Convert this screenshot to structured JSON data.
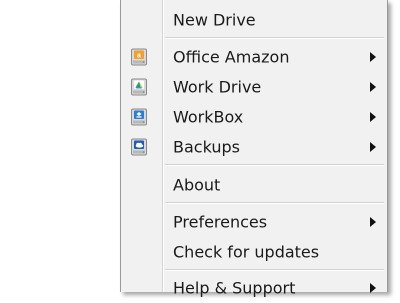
{
  "menu": {
    "new_drive": "New Drive",
    "office_amazon": "Office Amazon",
    "work_drive": "Work Drive",
    "workbox": "WorkBox",
    "backups": "Backups",
    "about": "About",
    "preferences": "Preferences",
    "check_updates": "Check for updates",
    "help_support": "Help & Support"
  },
  "icons": {
    "office_amazon": "amazon-drive-icon",
    "work_drive": "google-drive-icon",
    "workbox": "dropbox-drive-icon",
    "backups": "onedrive-drive-icon"
  },
  "colors": {
    "menu_bg": "#f1f1f1",
    "separator": "#d2d2d2",
    "text": "#1a1a1a",
    "amazon_accent": "#f0a030",
    "dropbox_accent": "#2a7fd4",
    "onedrive_accent": "#1c5cb8"
  }
}
